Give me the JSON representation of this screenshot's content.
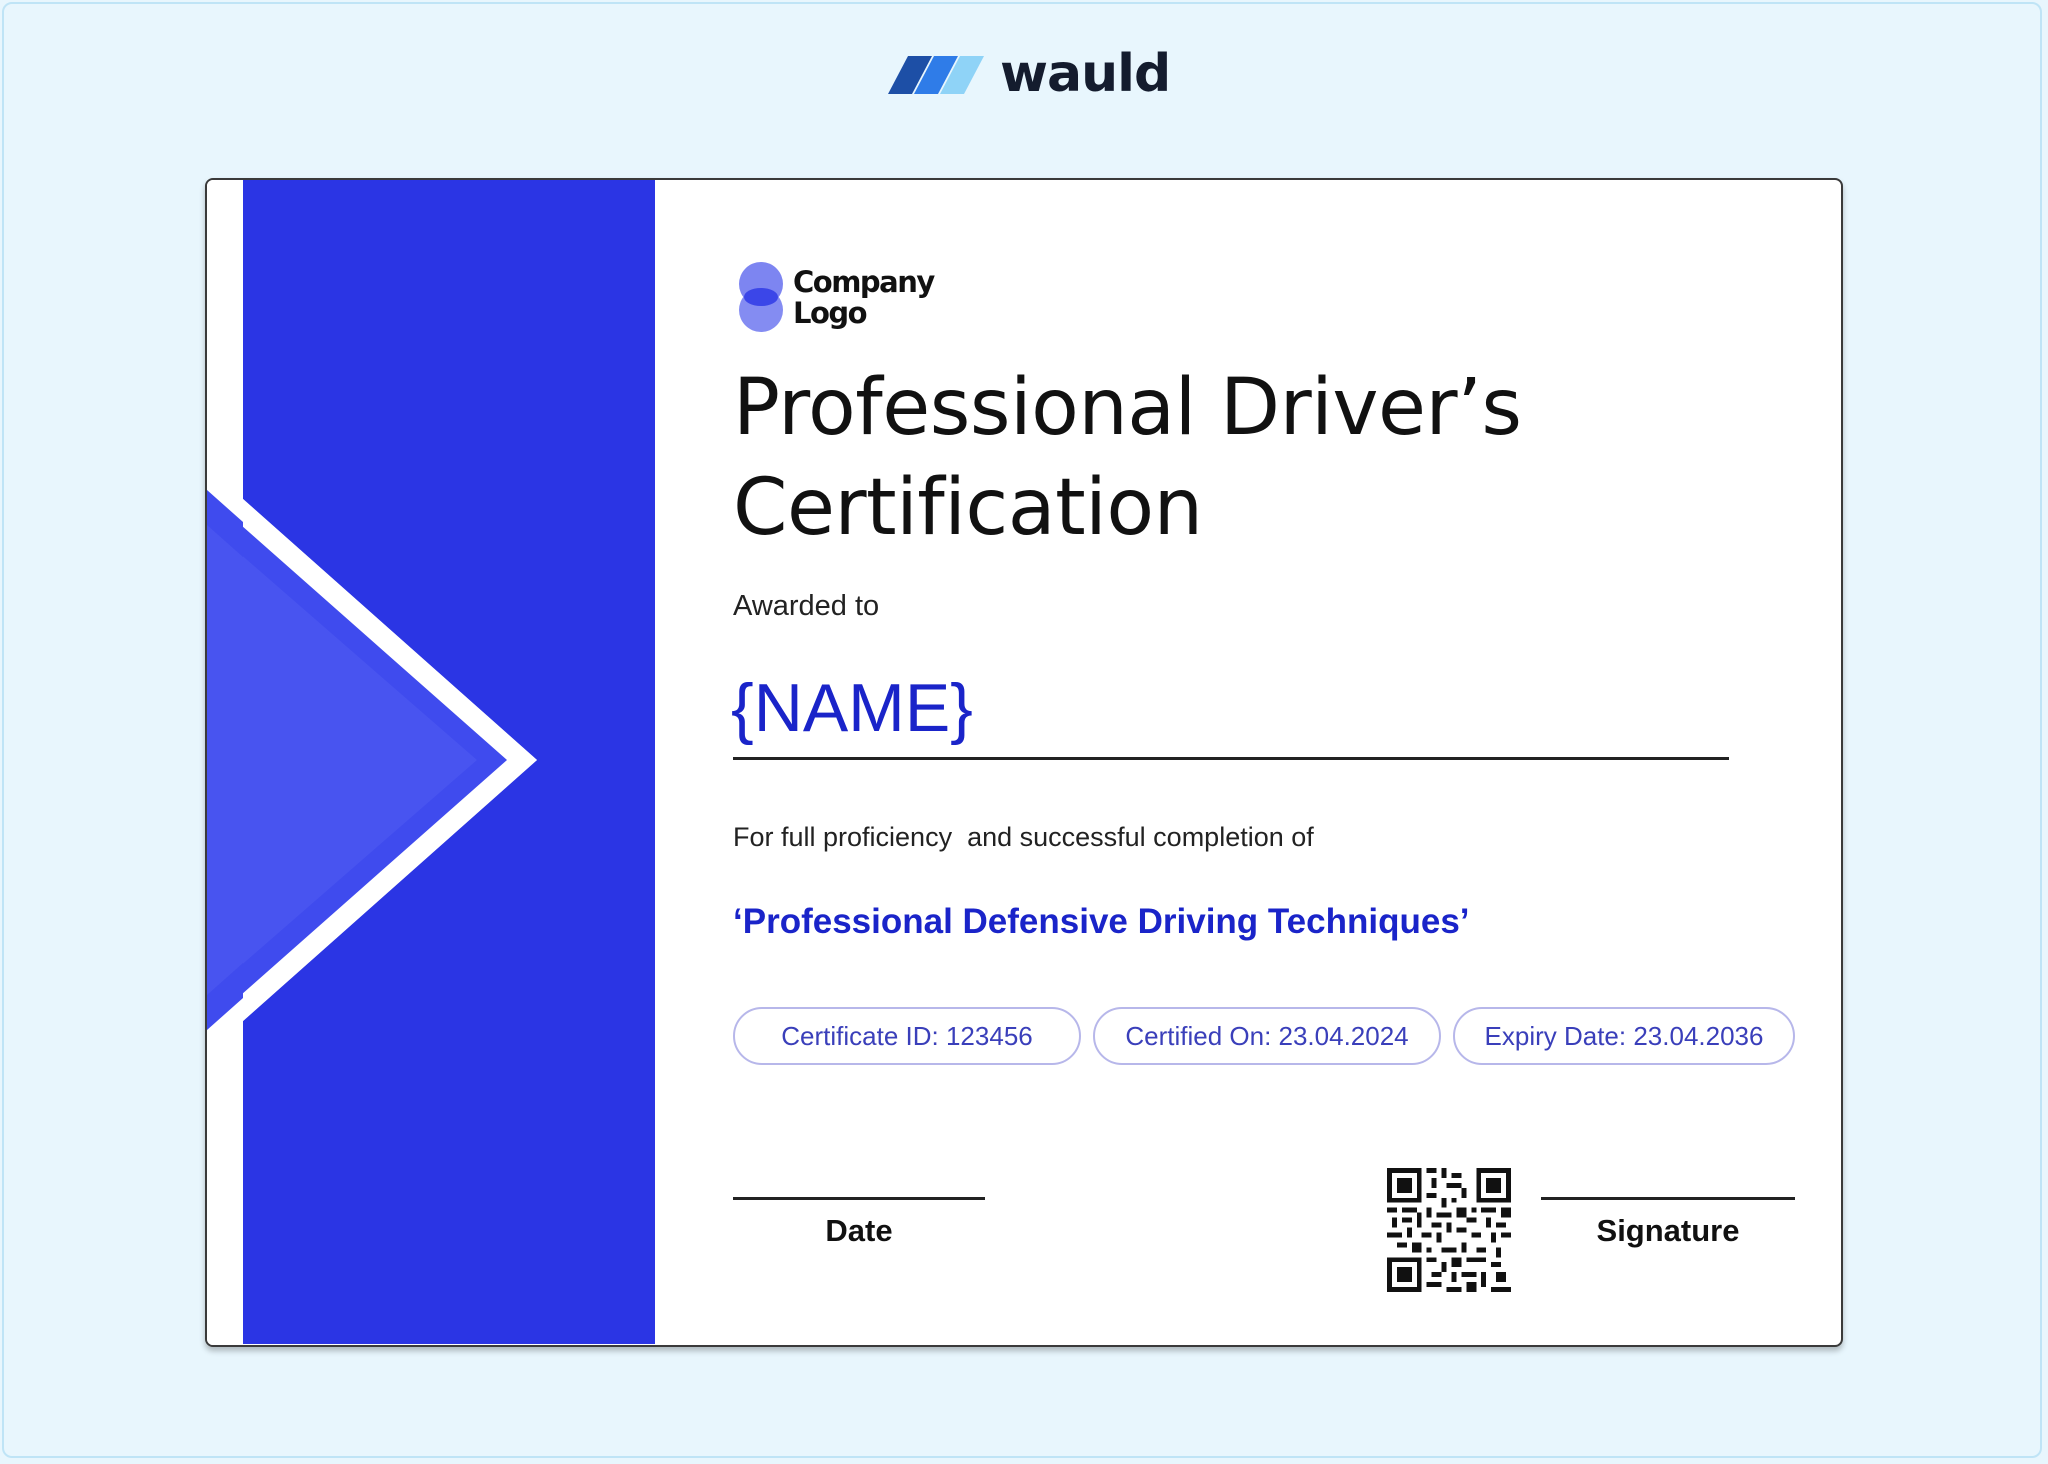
{
  "brand": {
    "name": "wauld",
    "icon": "wauld-logo-icon"
  },
  "certificate": {
    "company_logo": {
      "line1": "Company",
      "line2": "Logo",
      "icon": "company-logo-icon"
    },
    "title": "Professional Driver’s Certification",
    "awarded_to_label": "Awarded to",
    "recipient_name": "{NAME}",
    "proficiency_text": "For full proficiency  and successful completion of",
    "course_name": "‘Professional Defensive Driving Techniques’",
    "pills": {
      "certificate_id": "Certificate ID: 123456",
      "certified_on": "Certified On: 23.04.2024",
      "expiry_date": "Expiry Date: 23.04.2036"
    },
    "date_label": "Date",
    "signature_label": "Signature",
    "qr_icon": "qr-code-icon"
  },
  "colors": {
    "page_background": "#e8f6fd",
    "accent_blue": "#2b35e4",
    "text_blue": "#1a24c9",
    "chevron_light": "#4854f0"
  }
}
